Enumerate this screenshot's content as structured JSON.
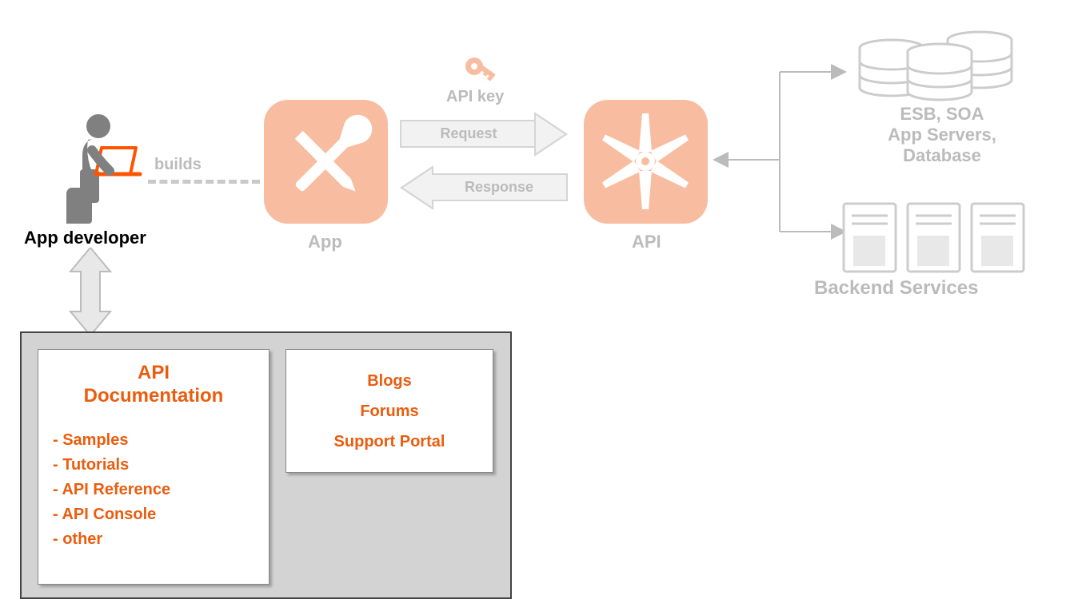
{
  "developer": {
    "label": "App developer"
  },
  "builds": {
    "label": "builds"
  },
  "app": {
    "label": "App"
  },
  "api": {
    "label": "API"
  },
  "apikey": {
    "label": "API key"
  },
  "request": {
    "label": "Request"
  },
  "response": {
    "label": "Response"
  },
  "backend": {
    "top_line1": "ESB, SOA",
    "top_line2": "App Servers,",
    "top_line3": "Database",
    "bottom": "Backend Services"
  },
  "docs": {
    "api_doc_title1": "API",
    "api_doc_title2": "Documentation",
    "items": {
      "i0": "- Samples",
      "i1": "- Tutorials",
      "i2": "- API Reference",
      "i3": "- API Console",
      "i4": "- other"
    },
    "right": {
      "r0": "Blogs",
      "r1": "Forums",
      "r2": "Support Portal"
    }
  }
}
